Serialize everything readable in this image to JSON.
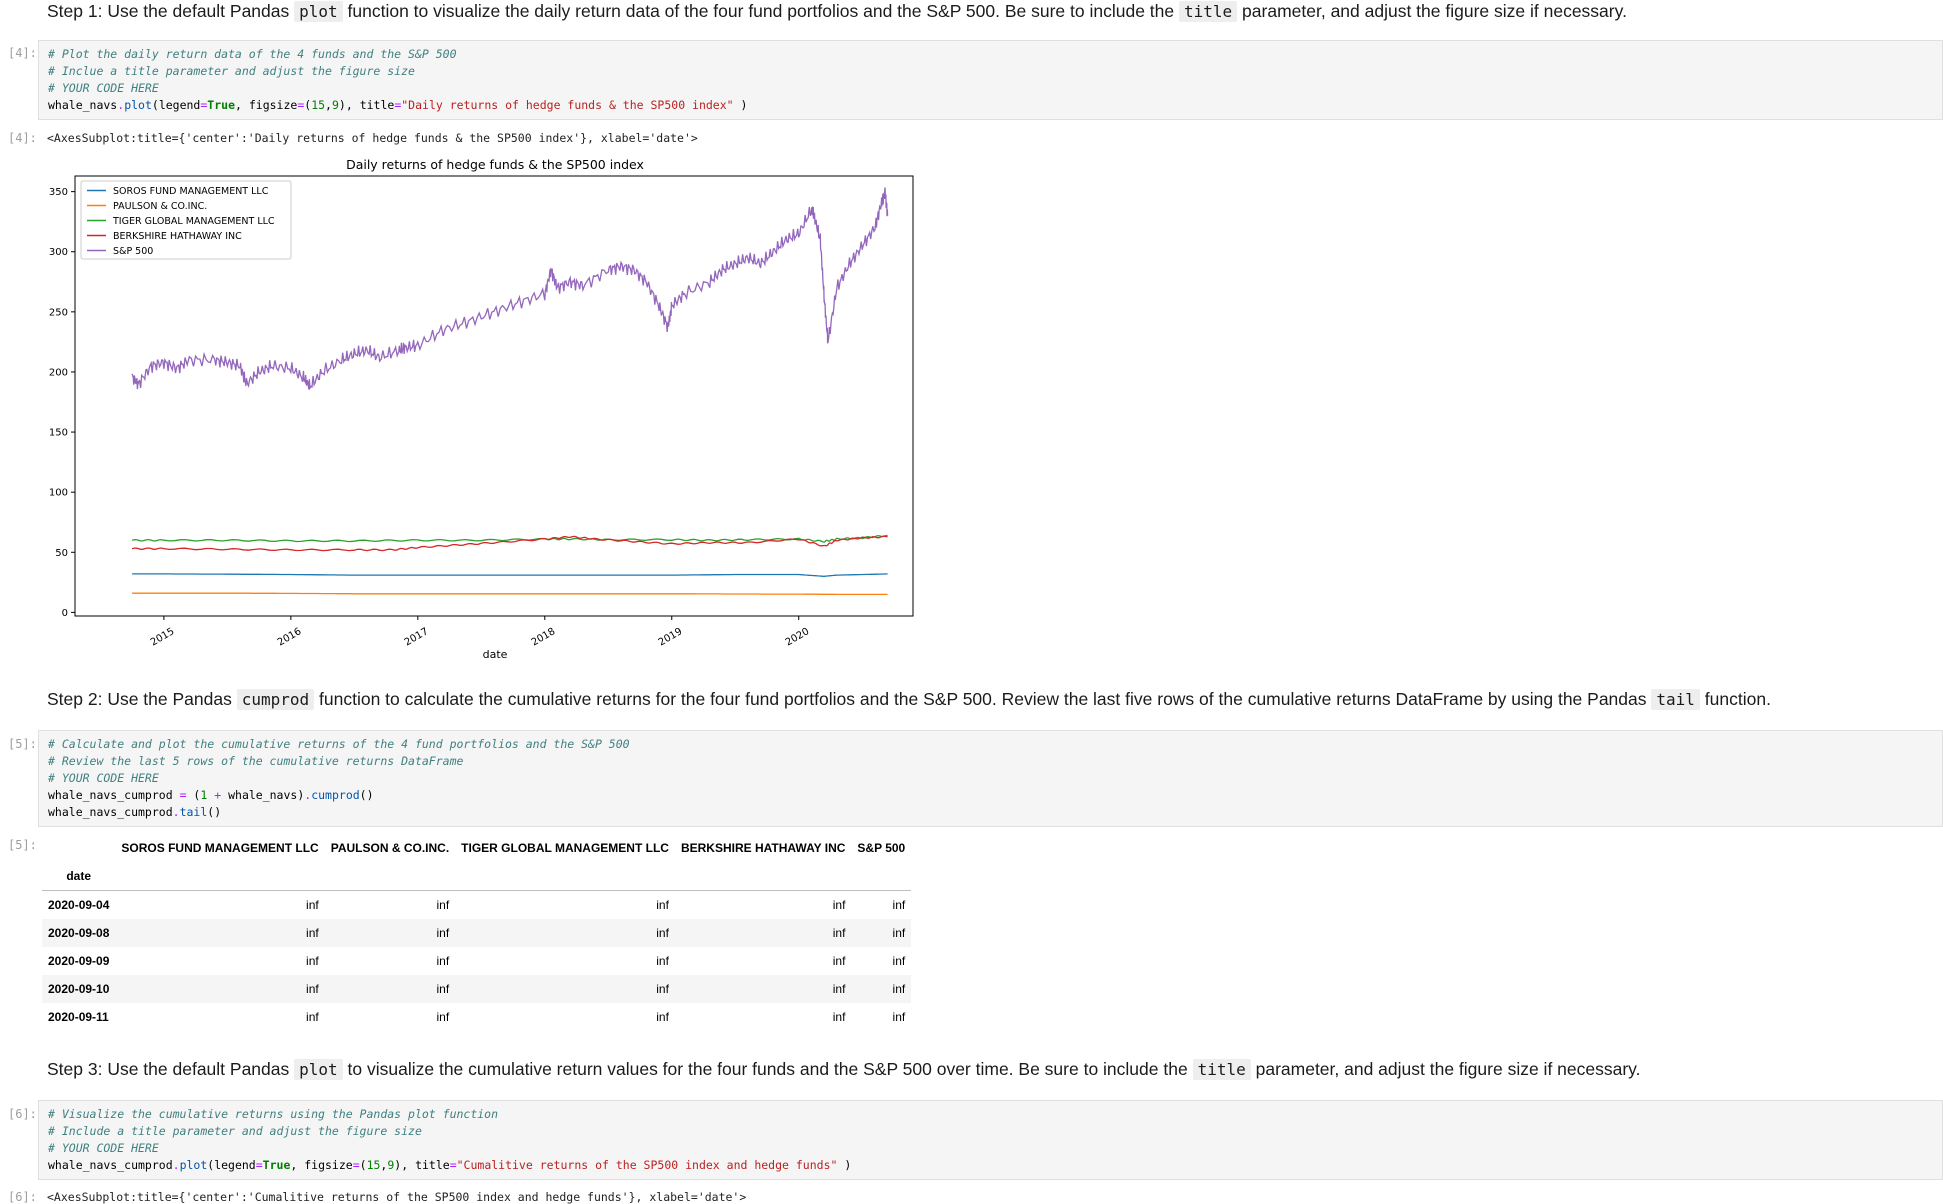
{
  "step1": {
    "prefix": "Step 1: Use the default Pandas",
    "code1": "plot",
    "mid": "function to visualize the daily return data of the four fund portfolios and the S&P 500. Be sure to include the",
    "code2": "title",
    "suffix": "parameter, and adjust the figure size if necessary."
  },
  "cell4": {
    "prompt": "[4]:",
    "lines": [
      {
        "cls": "c-com",
        "text": "# Plot the daily return data of the 4 funds and the S&P 500"
      },
      {
        "cls": "c-com",
        "text": "# Inclue a title parameter and adjust the figure size"
      },
      {
        "cls": "c-com",
        "text": "# YOUR CODE HERE"
      }
    ],
    "code_parts": [
      {
        "cls": "c-var",
        "text": "whale_navs"
      },
      {
        "cls": "c-op",
        "text": "."
      },
      {
        "cls": "c-fn",
        "text": "plot"
      },
      {
        "cls": "c-var",
        "text": "(legend"
      },
      {
        "cls": "c-op",
        "text": "="
      },
      {
        "cls": "c-kw",
        "text": "True"
      },
      {
        "cls": "c-var",
        "text": ", figsize"
      },
      {
        "cls": "c-op",
        "text": "="
      },
      {
        "cls": "c-var",
        "text": "("
      },
      {
        "cls": "c-num",
        "text": "15"
      },
      {
        "cls": "c-var",
        "text": ","
      },
      {
        "cls": "c-num",
        "text": "9"
      },
      {
        "cls": "c-var",
        "text": "), title"
      },
      {
        "cls": "c-op",
        "text": "="
      },
      {
        "cls": "c-str",
        "text": "\"Daily returns of hedge funds & the SP500 index\""
      },
      {
        "cls": "c-var",
        "text": " )"
      }
    ],
    "out_prompt": "[4]:",
    "out_text": "<AxesSubplot:title={'center':'Daily returns of hedge funds & the SP500 index'}, xlabel='date'>"
  },
  "chart_data": {
    "type": "line",
    "title": "Daily returns of hedge funds & the SP500 index",
    "xlabel": "date",
    "ylabel": "",
    "x_ticks": [
      "2015",
      "2016",
      "2017",
      "2018",
      "2019",
      "2020"
    ],
    "y_ticks": [
      0,
      50,
      100,
      150,
      200,
      250,
      300,
      350
    ],
    "ylim": [
      -3,
      363
    ],
    "xlim": [
      2014.3,
      2020.9
    ],
    "grid": false,
    "legend_position": "upper-left",
    "series": [
      {
        "name": "SOROS FUND MANAGEMENT LLC",
        "color": "#1f77b4",
        "x": [
          2014.75,
          2015.0,
          2015.5,
          2016.0,
          2016.5,
          2017.0,
          2017.5,
          2018.0,
          2018.5,
          2019.0,
          2019.5,
          2020.0,
          2020.2,
          2020.3,
          2020.5,
          2020.7
        ],
        "y": [
          32,
          32,
          31.8,
          31.5,
          31,
          31,
          31,
          31,
          31,
          31,
          31.5,
          31.5,
          30,
          31,
          31.5,
          32
        ]
      },
      {
        "name": "PAULSON & CO.INC.",
        "color": "#ff7f0e",
        "x": [
          2014.75,
          2015.0,
          2015.5,
          2016.0,
          2016.5,
          2017.0,
          2017.5,
          2018.0,
          2018.5,
          2019.0,
          2019.5,
          2020.0,
          2020.3,
          2020.7
        ],
        "y": [
          16,
          16,
          16,
          15.8,
          15.5,
          15.5,
          15.5,
          15.5,
          15.5,
          15.5,
          15.3,
          15.2,
          15,
          15
        ]
      },
      {
        "name": "TIGER GLOBAL MANAGEMENT LLC",
        "color": "#2ca02c",
        "x": [
          2014.75,
          2015.0,
          2015.5,
          2016.0,
          2016.5,
          2017.0,
          2017.5,
          2018.0,
          2018.2,
          2018.5,
          2019.0,
          2019.3,
          2019.6,
          2020.0,
          2020.2,
          2020.3,
          2020.5,
          2020.7
        ],
        "y": [
          60,
          60,
          60,
          59.5,
          59.5,
          60,
          60,
          61,
          61,
          60.5,
          60.5,
          60,
          60.5,
          61,
          59,
          61,
          62,
          64
        ]
      },
      {
        "name": "BERKSHIRE HATHAWAY INC",
        "color": "#d62728",
        "x": [
          2014.75,
          2015.0,
          2015.5,
          2016.0,
          2016.5,
          2016.8,
          2017.0,
          2017.3,
          2017.6,
          2018.0,
          2018.2,
          2018.4,
          2018.7,
          2019.0,
          2019.3,
          2019.6,
          2020.0,
          2020.2,
          2020.3,
          2020.5,
          2020.7
        ],
        "y": [
          53,
          53,
          52.5,
          52,
          52,
          52,
          54,
          56,
          58,
          61,
          63,
          61,
          59,
          57,
          58,
          58,
          61,
          55,
          60,
          62,
          63
        ]
      },
      {
        "name": "S&P 500",
        "color": "#9467bd",
        "x": [
          2014.75,
          2014.8,
          2014.9,
          2015.0,
          2015.1,
          2015.2,
          2015.4,
          2015.5,
          2015.6,
          2015.65,
          2015.75,
          2015.85,
          2016.0,
          2016.1,
          2016.15,
          2016.25,
          2016.4,
          2016.5,
          2016.6,
          2016.7,
          2016.85,
          2016.9,
          2017.0,
          2017.2,
          2017.4,
          2017.6,
          2017.8,
          2018.0,
          2018.05,
          2018.1,
          2018.2,
          2018.3,
          2018.5,
          2018.6,
          2018.7,
          2018.8,
          2018.9,
          2018.97,
          2019.0,
          2019.1,
          2019.3,
          2019.4,
          2019.5,
          2019.6,
          2019.7,
          2019.8,
          2019.9,
          2020.0,
          2020.1,
          2020.12,
          2020.17,
          2020.2,
          2020.23,
          2020.3,
          2020.4,
          2020.5,
          2020.6,
          2020.65,
          2020.68,
          2020.7
        ],
        "y": [
          196,
          190,
          205,
          208,
          203,
          210,
          210,
          208,
          205,
          190,
          200,
          205,
          203,
          195,
          188,
          200,
          210,
          215,
          218,
          212,
          218,
          220,
          222,
          235,
          242,
          250,
          258,
          265,
          285,
          270,
          275,
          272,
          285,
          288,
          285,
          275,
          255,
          237,
          255,
          265,
          275,
          285,
          290,
          295,
          290,
          300,
          310,
          315,
          335,
          330,
          310,
          262,
          225,
          270,
          290,
          305,
          320,
          340,
          350,
          330
        ]
      }
    ]
  },
  "step2": {
    "prefix": "Step 2: Use the Pandas",
    "code1": "cumprod",
    "mid": "function to calculate the cumulative returns for the four fund portfolios and the S&P 500. Review the last five rows of the cumulative returns DataFrame by using the Pandas",
    "code2": "tail",
    "suffix": "function."
  },
  "cell5": {
    "prompt": "[5]:",
    "lines": [
      {
        "cls": "c-com",
        "text": "# Calculate and plot the cumulative returns of the 4 fund portfolios and the S&P 500"
      },
      {
        "cls": "c-com",
        "text": "# Review the last 5 rows of the cumulative returns DataFrame"
      },
      {
        "cls": "c-com",
        "text": "# YOUR CODE HERE"
      }
    ],
    "line4_parts": [
      {
        "cls": "c-var",
        "text": "whale_navs_cumprod "
      },
      {
        "cls": "c-op",
        "text": "="
      },
      {
        "cls": "c-var",
        "text": " ("
      },
      {
        "cls": "c-num",
        "text": "1"
      },
      {
        "cls": "c-var",
        "text": " "
      },
      {
        "cls": "c-op",
        "text": "+"
      },
      {
        "cls": "c-var",
        "text": " whale_navs)"
      },
      {
        "cls": "c-op",
        "text": "."
      },
      {
        "cls": "c-fn",
        "text": "cumprod"
      },
      {
        "cls": "c-var",
        "text": "()"
      }
    ],
    "line5_parts": [
      {
        "cls": "c-var",
        "text": "whale_navs_cumprod"
      },
      {
        "cls": "c-op",
        "text": "."
      },
      {
        "cls": "c-fn",
        "text": "tail"
      },
      {
        "cls": "c-var",
        "text": "()"
      }
    ],
    "out_prompt": "[5]:"
  },
  "table": {
    "columns": [
      "SOROS FUND MANAGEMENT LLC",
      "PAULSON & CO.INC.",
      "TIGER GLOBAL MANAGEMENT LLC",
      "BERKSHIRE HATHAWAY INC",
      "S&P 500"
    ],
    "index_name": "date",
    "rows": [
      {
        "date": "2020-09-04",
        "values": [
          "inf",
          "inf",
          "inf",
          "inf",
          "inf"
        ]
      },
      {
        "date": "2020-09-08",
        "values": [
          "inf",
          "inf",
          "inf",
          "inf",
          "inf"
        ]
      },
      {
        "date": "2020-09-09",
        "values": [
          "inf",
          "inf",
          "inf",
          "inf",
          "inf"
        ]
      },
      {
        "date": "2020-09-10",
        "values": [
          "inf",
          "inf",
          "inf",
          "inf",
          "inf"
        ]
      },
      {
        "date": "2020-09-11",
        "values": [
          "inf",
          "inf",
          "inf",
          "inf",
          "inf"
        ]
      }
    ]
  },
  "step3": {
    "prefix": "Step 3: Use the default Pandas",
    "code1": "plot",
    "mid": "to visualize the cumulative return values for the four funds and the S&P 500 over time. Be sure to include the",
    "code2": "title",
    "suffix": "parameter, and adjust the figure size if necessary."
  },
  "cell6": {
    "prompt": "[6]:",
    "lines": [
      {
        "cls": "c-com",
        "text": "# Visualize the cumulative returns using the Pandas plot function"
      },
      {
        "cls": "c-com",
        "text": "# Include a title parameter and adjust the figure size"
      },
      {
        "cls": "c-com",
        "text": "# YOUR CODE HERE"
      }
    ],
    "code_parts": [
      {
        "cls": "c-var",
        "text": "whale_navs_cumprod"
      },
      {
        "cls": "c-op",
        "text": "."
      },
      {
        "cls": "c-fn",
        "text": "plot"
      },
      {
        "cls": "c-var",
        "text": "(legend"
      },
      {
        "cls": "c-op",
        "text": "="
      },
      {
        "cls": "c-kw",
        "text": "True"
      },
      {
        "cls": "c-var",
        "text": ", figsize"
      },
      {
        "cls": "c-op",
        "text": "="
      },
      {
        "cls": "c-var",
        "text": "("
      },
      {
        "cls": "c-num",
        "text": "15"
      },
      {
        "cls": "c-var",
        "text": ","
      },
      {
        "cls": "c-num",
        "text": "9"
      },
      {
        "cls": "c-var",
        "text": "), title"
      },
      {
        "cls": "c-op",
        "text": "="
      },
      {
        "cls": "c-str",
        "text": "\"Cumalitive returns of the SP500 index and hedge funds\""
      },
      {
        "cls": "c-var",
        "text": " )"
      }
    ],
    "out_prompt": "[6]:",
    "out_text": "<AxesSubplot:title={'center':'Cumalitive returns of the SP500 index and hedge funds'}, xlabel='date'>"
  }
}
